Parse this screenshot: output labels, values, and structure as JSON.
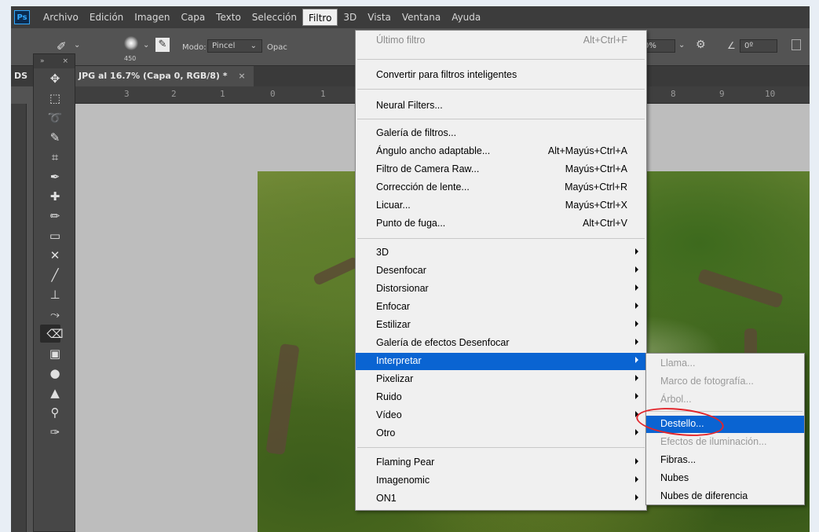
{
  "menubar": {
    "logo": "Ps",
    "items": [
      "Archivo",
      "Edición",
      "Imagen",
      "Capa",
      "Texto",
      "Selección",
      "Filtro",
      "3D",
      "Vista",
      "Ventana",
      "Ayuda"
    ],
    "active": "Filtro"
  },
  "options": {
    "brush_size": "450",
    "mode_label": "Modo:",
    "mode_value": "Pincel",
    "opacity_label": "Opac",
    "flow_value": "0%",
    "angle_value": "0º"
  },
  "document": {
    "tab_left": "DS",
    "tab_title": "JPG al 16.7% (Capa 0, RGB/8) *"
  },
  "ruler": {
    "ticks": [
      "3",
      "2",
      "1",
      "0",
      "1",
      "8",
      "9",
      "10"
    ]
  },
  "toolbar": {
    "head_left": "»",
    "head_right": "×",
    "tools": [
      "move-tool",
      "marquee-tool",
      "lasso-tool",
      "quick-selection-tool",
      "crop-tool",
      "eyedropper-tool",
      "spot-healing-tool",
      "brush-tool",
      "stamp-tool",
      "history-brush-tool",
      "eraser-tool-alt",
      "pen-tool",
      "type-tool",
      "path-selection-tool",
      "eraser-tool",
      "gradient-tool",
      "blur-tool",
      "shape-tool",
      "hand-tool",
      "zoom-tool"
    ]
  },
  "filter_menu": {
    "items": [
      {
        "label": "Último filtro",
        "shortcut": "Alt+Ctrl+F",
        "disabled": true
      },
      {
        "label": "Convertir para filtros inteligentes"
      },
      {
        "label": "Neural Filters..."
      },
      {
        "label": "Galería de filtros..."
      },
      {
        "label": "Ángulo ancho adaptable...",
        "shortcut": "Alt+Mayús+Ctrl+A"
      },
      {
        "label": "Filtro de Camera Raw...",
        "shortcut": "Mayús+Ctrl+A"
      },
      {
        "label": "Corrección de lente...",
        "shortcut": "Mayús+Ctrl+R"
      },
      {
        "label": "Licuar...",
        "shortcut": "Mayús+Ctrl+X"
      },
      {
        "label": "Punto de fuga...",
        "shortcut": "Alt+Ctrl+V"
      },
      {
        "label": "3D",
        "submenu": true
      },
      {
        "label": "Desenfocar",
        "submenu": true
      },
      {
        "label": "Distorsionar",
        "submenu": true
      },
      {
        "label": "Enfocar",
        "submenu": true
      },
      {
        "label": "Estilizar",
        "submenu": true
      },
      {
        "label": "Galería de efectos Desenfocar",
        "submenu": true
      },
      {
        "label": "Interpretar",
        "submenu": true,
        "highlighted": true
      },
      {
        "label": "Pixelizar",
        "submenu": true
      },
      {
        "label": "Ruido",
        "submenu": true
      },
      {
        "label": "Vídeo",
        "submenu": true
      },
      {
        "label": "Otro",
        "submenu": true
      },
      {
        "label": "Flaming Pear",
        "submenu": true
      },
      {
        "label": "Imagenomic",
        "submenu": true
      },
      {
        "label": "ON1",
        "submenu": true
      }
    ]
  },
  "submenu_interpretar": {
    "items": [
      {
        "label": "Llama...",
        "disabled": true
      },
      {
        "label": "Marco de fotografía...",
        "disabled": true
      },
      {
        "label": "Árbol...",
        "disabled": true
      },
      {
        "label": "Destello...",
        "highlighted": true
      },
      {
        "label": "Efectos de iluminación...",
        "disabled": true
      },
      {
        "label": "Fibras..."
      },
      {
        "label": "Nubes"
      },
      {
        "label": "Nubes de diferencia"
      }
    ]
  },
  "colors": {
    "highlight": "#0a64d2",
    "annotation": "#e2252b"
  }
}
